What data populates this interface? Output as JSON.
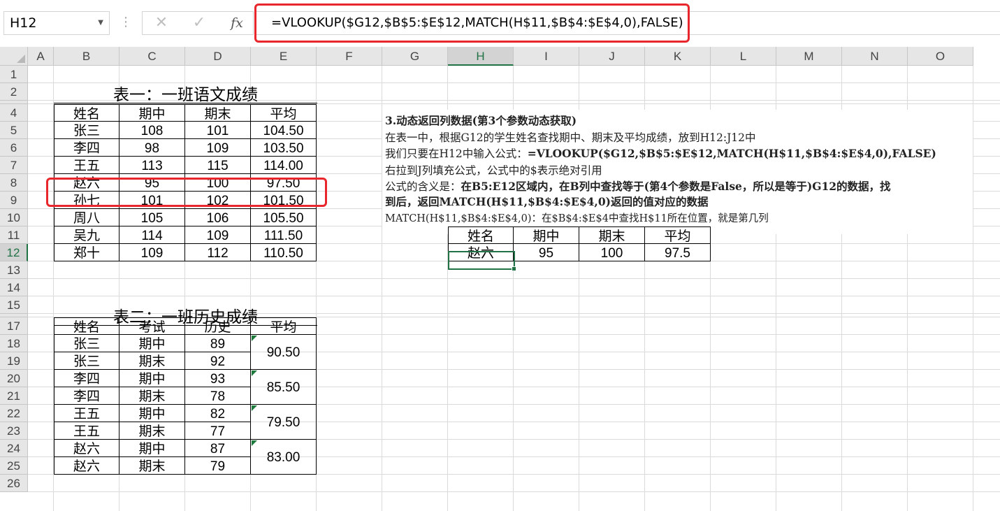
{
  "namebox": {
    "value": "H12",
    "icon": "chevron-down-icon"
  },
  "formula_bar": {
    "dots": "⋮",
    "cancel_icon": "✕",
    "enter_icon": "✓",
    "fx_label": "fx",
    "formula": "=VLOOKUP($G12,$B$5:$E$12,MATCH(H$11,$B$4:$E$4,0),FALSE)"
  },
  "columns": [
    "A",
    "B",
    "C",
    "D",
    "E",
    "F",
    "G",
    "H",
    "I",
    "J",
    "K",
    "L",
    "M",
    "N",
    "O"
  ],
  "rows": [
    "1",
    "2",
    "3",
    "4",
    "5",
    "6",
    "7",
    "8",
    "9",
    "10",
    "11",
    "12",
    "13",
    "14",
    "15",
    "16",
    "17",
    "18",
    "19",
    "20",
    "21",
    "22",
    "23",
    "24",
    "25",
    "26"
  ],
  "selected": {
    "column": "H",
    "row": "12"
  },
  "table1": {
    "title": "表一：一班语文成绩",
    "headers": [
      "姓名",
      "期中",
      "期末",
      "平均"
    ],
    "rows": [
      [
        "张三",
        "108",
        "101",
        "104.50"
      ],
      [
        "李四",
        "98",
        "109",
        "103.50"
      ],
      [
        "王五",
        "113",
        "115",
        "114.00"
      ],
      [
        "赵六",
        "95",
        "100",
        "97.50"
      ],
      [
        "孙七",
        "101",
        "102",
        "101.50"
      ],
      [
        "周八",
        "105",
        "106",
        "105.50"
      ],
      [
        "吴九",
        "114",
        "109",
        "111.50"
      ],
      [
        "郑十",
        "109",
        "112",
        "110.50"
      ]
    ]
  },
  "table2": {
    "title": "表二：一班历史成绩",
    "headers": [
      "姓名",
      "考试",
      "历史",
      "平均"
    ],
    "rows": [
      [
        "张三",
        "期中",
        "89"
      ],
      [
        "张三",
        "期末",
        "92"
      ],
      [
        "李四",
        "期中",
        "93"
      ],
      [
        "李四",
        "期末",
        "78"
      ],
      [
        "王五",
        "期中",
        "82"
      ],
      [
        "王五",
        "期末",
        "77"
      ],
      [
        "赵六",
        "期中",
        "87"
      ],
      [
        "赵六",
        "期末",
        "79"
      ]
    ],
    "averages": [
      "90.50",
      "85.50",
      "79.50",
      "83.00"
    ]
  },
  "notes": {
    "line1": "3.动态返回列数据(第3个参数动态获取)",
    "line2": "在表一中，根据G12的学生姓名查找期中、期末及平均成绩，放到H12:J12中",
    "line3_prefix": "我们只要在H12中输入公式：",
    "line3_formula": "=VLOOKUP($G12,$B$5:$E$12,MATCH(H$11,$B$4:$E$4,0),FALSE)",
    "line4": "右拉到J列填充公式，公式中的$表示绝对引用",
    "line5_prefix": "公式的含义是：",
    "line5_bold": "在B5:E12区域内，在B列中查找等于(第4个参数是False，所以是等于)G12的数据，找",
    "line6": "到后，返回MATCH(H$11,$B$4:$E$4,0)返回的值对应的数据",
    "line7": "MATCH(H$11,$B$4:$E$4,0)：在$B$4:$E$4中查找H$11所在位置，就是第几列"
  },
  "result_table": {
    "headers": [
      "姓名",
      "期中",
      "期末",
      "平均"
    ],
    "values": [
      "赵六",
      "95",
      "100",
      "97.5"
    ]
  },
  "colors": {
    "accent": "#217346",
    "highlight": "#e8262b"
  }
}
